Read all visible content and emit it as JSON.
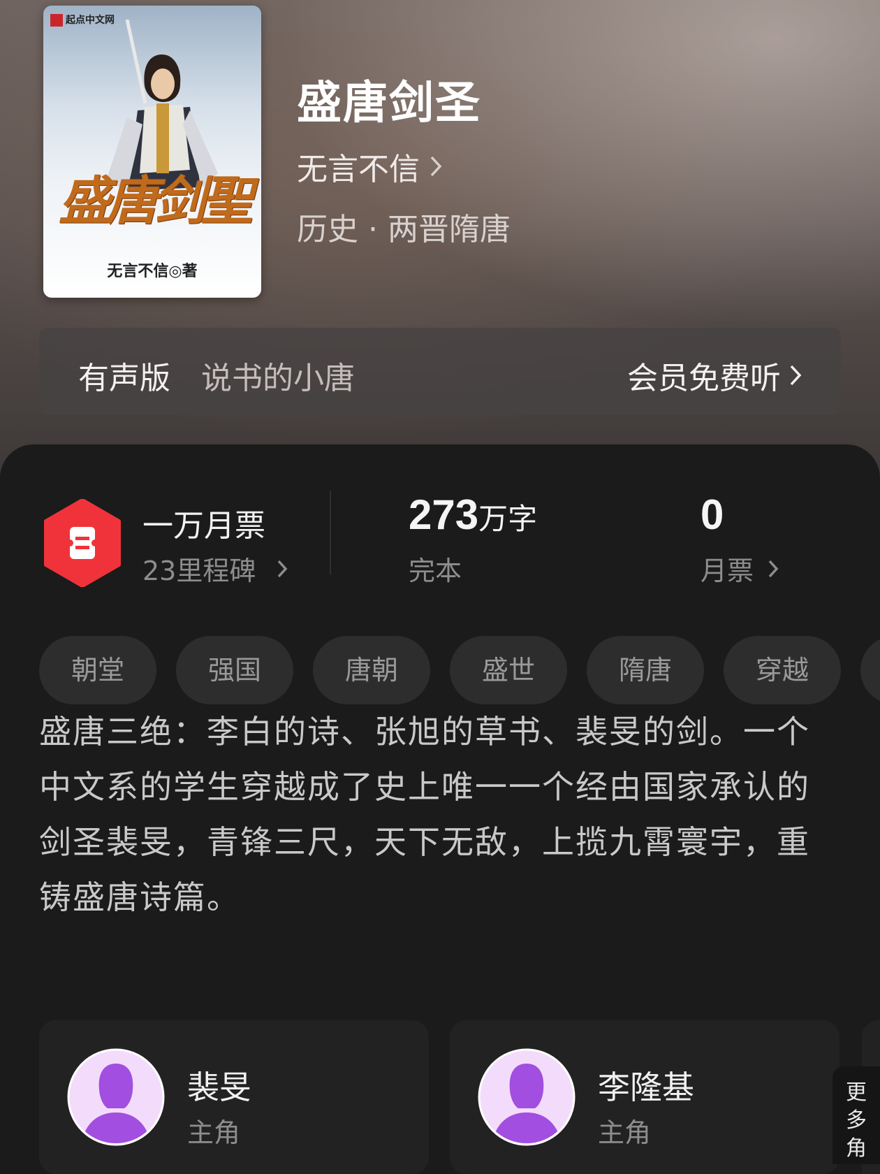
{
  "book": {
    "title": "盛唐剑圣",
    "author": "无言不信",
    "genre": "历史 · 两晋隋唐",
    "cover": {
      "publisher": "起点中文网",
      "title_art": "盛唐剑聖",
      "author_credit": "无言不信◎著"
    }
  },
  "audio": {
    "label": "有声版",
    "narrator": "说书的小唐",
    "cta": "会员免费听"
  },
  "stats": {
    "rank_main": "一万月票",
    "rank_sub": "23里程碑",
    "words_number": "273",
    "words_unit": "万字",
    "status": "完本",
    "monthly_votes": "0",
    "monthly_votes_label": "月票"
  },
  "tags": [
    "朝堂",
    "强国",
    "唐朝",
    "盛世",
    "隋唐",
    "穿越"
  ],
  "synopsis": "盛唐三绝：李白的诗、张旭的草书、裴旻的剑。一个中文系的学生穿越成了史上唯一一个经由国家承认的剑圣裴旻，青锋三尺，天下无敌，上揽九霄寰宇，重铸盛唐诗篇。",
  "characters": [
    {
      "name": "裴旻",
      "role": "主角"
    },
    {
      "name": "李隆基",
      "role": "主角"
    }
  ],
  "more_roles_label": "更多角",
  "colors": {
    "badge_red": "#f0333a",
    "avatar_purple": "#a24ee0",
    "avatar_bg": "#f3dcfb"
  }
}
